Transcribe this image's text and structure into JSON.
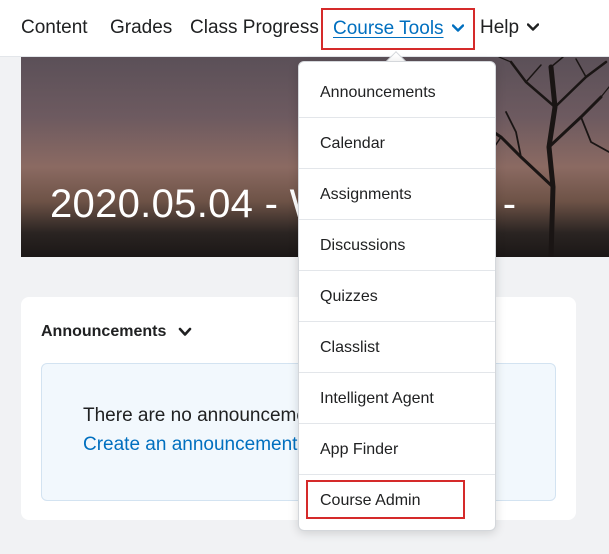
{
  "nav": {
    "items": [
      {
        "label": "Content"
      },
      {
        "label": "Grades"
      },
      {
        "label": "Class Progress"
      },
      {
        "label": "Course Tools"
      },
      {
        "label": "Help"
      }
    ]
  },
  "banner": {
    "title": "2020.05.04 - Web Demo -"
  },
  "announcements_widget": {
    "title": "Announcements",
    "empty_text": "There are no announcements",
    "create_link": "Create an announcement"
  },
  "dropdown": {
    "items": [
      {
        "label": "Announcements"
      },
      {
        "label": "Calendar"
      },
      {
        "label": "Assignments"
      },
      {
        "label": "Discussions"
      },
      {
        "label": "Quizzes"
      },
      {
        "label": "Classlist"
      },
      {
        "label": "Intelligent Agent"
      },
      {
        "label": "App Finder"
      },
      {
        "label": "Course Admin"
      }
    ]
  },
  "colors": {
    "accent": "#006fbf",
    "highlight": "#d52a2a"
  }
}
